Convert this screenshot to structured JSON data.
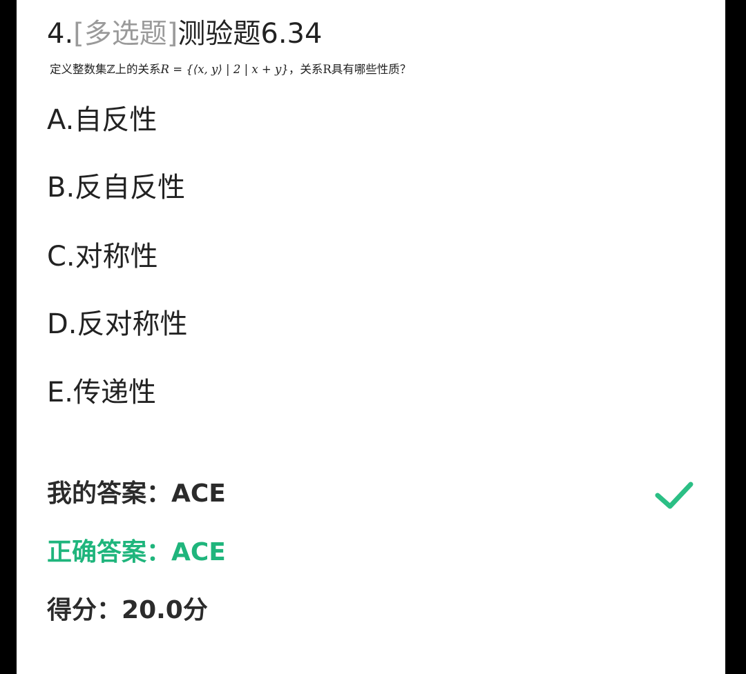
{
  "question": {
    "number": "4.",
    "type": "[多选题]",
    "title": "测验题6.34",
    "stem_prefix": "定义整数集ℤ上的关系",
    "stem_formula": "R = {⟨x, y⟩ | 2 | x + y}",
    "stem_suffix": "，关系R具有哪些性质？"
  },
  "options": [
    {
      "label": "A.自反性"
    },
    {
      "label": "B.反自反性"
    },
    {
      "label": "C.对称性"
    },
    {
      "label": "D.反对称性"
    },
    {
      "label": "E.传递性"
    }
  ],
  "result": {
    "my_answer_label": "我的答案：",
    "my_answer_value": "ACE",
    "correct_answer_label": "正确答案：",
    "correct_answer_value": "ACE",
    "score_label": "得分：",
    "score_value": "20.0分"
  },
  "icons": {
    "check": "checkmark-icon"
  },
  "colors": {
    "correct_green": "#1fb57c",
    "check_green": "#2bbf85",
    "question_type_gray": "#9a9a9a",
    "text": "#222222"
  }
}
